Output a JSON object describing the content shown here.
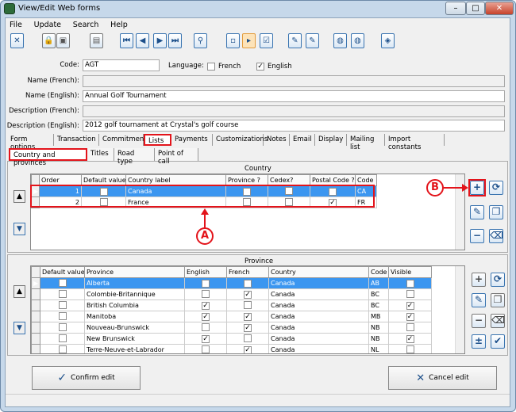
{
  "window": {
    "title": "View/Edit Web forms"
  },
  "menu": [
    "File",
    "Update",
    "Search",
    "Help"
  ],
  "form": {
    "code_label": "Code:",
    "code": "AGT",
    "language_label": "Language:",
    "lang_french": "French",
    "lang_english": "English",
    "french_checked": false,
    "english_checked": true,
    "name_fr_label": "Name (French):",
    "name_fr": "",
    "name_en_label": "Name (English):",
    "name_en": "Annual Golf Tournament",
    "desc_fr_label": "Description (French):",
    "desc_fr": "",
    "desc_en_label": "Description (English):",
    "desc_en": "2012 golf tournament at Crystal's golf course"
  },
  "tabs": [
    "Form options",
    "Transaction",
    "Commitment",
    "Lists",
    "Payments",
    "Customizations",
    "Notes",
    "Email",
    "Display",
    "Mailing list",
    "Import constants"
  ],
  "active_tab": "Lists",
  "subtabs": [
    "Country and provinces",
    "Titles",
    "Road type",
    "Point of call"
  ],
  "country": {
    "title": "Country",
    "columns": [
      "Order",
      "Default value",
      "Country label",
      "Province ?",
      "Cedex?",
      "Postal Code ?",
      "Code"
    ],
    "rows": [
      {
        "order": "1",
        "default": true,
        "label": "Canada",
        "province": true,
        "cedex": false,
        "postal": true,
        "code": "CA"
      },
      {
        "order": "2",
        "default": false,
        "label": "France",
        "province": false,
        "cedex": false,
        "postal": true,
        "code": "FR"
      }
    ]
  },
  "province": {
    "title": "Province",
    "columns": [
      "Default value",
      "Province",
      "English",
      "French",
      "Country",
      "Code",
      "Visible"
    ],
    "rows": [
      {
        "default": false,
        "name": "Alberta",
        "en": true,
        "fr": true,
        "country": "Canada",
        "code": "AB",
        "visible": true
      },
      {
        "default": false,
        "name": "Colombie-Britannique",
        "en": false,
        "fr": true,
        "country": "Canada",
        "code": "BC",
        "visible": false
      },
      {
        "default": false,
        "name": "British Columbia",
        "en": true,
        "fr": false,
        "country": "Canada",
        "code": "BC",
        "visible": true
      },
      {
        "default": false,
        "name": "Manitoba",
        "en": true,
        "fr": true,
        "country": "Canada",
        "code": "MB",
        "visible": true
      },
      {
        "default": false,
        "name": "Nouveau-Brunswick",
        "en": false,
        "fr": true,
        "country": "Canada",
        "code": "NB",
        "visible": false
      },
      {
        "default": false,
        "name": "New Brunswick",
        "en": true,
        "fr": false,
        "country": "Canada",
        "code": "NB",
        "visible": true
      },
      {
        "default": false,
        "name": "Terre-Neuve-et-Labrador",
        "en": false,
        "fr": true,
        "country": "Canada",
        "code": "NL",
        "visible": false
      }
    ]
  },
  "annotations": {
    "a": "A",
    "b": "B"
  },
  "buttons": {
    "confirm": "Confirm edit",
    "cancel": "Cancel edit"
  },
  "colors": {
    "selection": "#3b96f0",
    "annotation": "#e3141b"
  }
}
